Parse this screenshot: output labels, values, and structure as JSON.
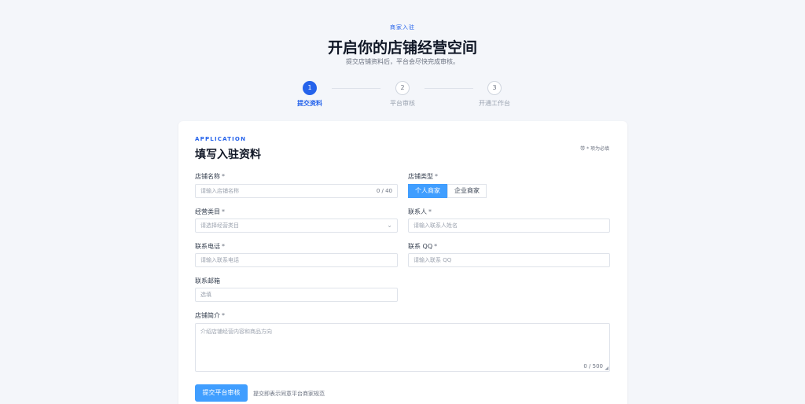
{
  "hero": {
    "eyebrow": "商家入驻",
    "title": "开启你的店铺经营空间",
    "subtitle": "提交店铺资料后，平台会尽快完成审核。"
  },
  "steps": [
    {
      "number": "1",
      "label": "提交资料",
      "active": true
    },
    {
      "number": "2",
      "label": "平台审核",
      "active": false
    },
    {
      "number": "3",
      "label": "开通工作台",
      "active": false
    }
  ],
  "form": {
    "kicker": "APPLICATION",
    "title": "填写入驻资料",
    "required_note": "带 * 项为必填",
    "required_mark": "*",
    "store_name": {
      "label": "店铺名称",
      "placeholder": "请输入店铺名称",
      "counter": "0 / 40"
    },
    "store_type": {
      "label": "店铺类型",
      "options": [
        "个人商家",
        "企业商家"
      ],
      "selected": "个人商家"
    },
    "category": {
      "label": "经营类目",
      "placeholder": "请选择经营类目"
    },
    "contact": {
      "label": "联系人",
      "placeholder": "请输入联系人姓名"
    },
    "phone": {
      "label": "联系电话",
      "placeholder": "请输入联系电话"
    },
    "qq": {
      "label": "联系 QQ",
      "placeholder": "请输入联系 QQ"
    },
    "email": {
      "label": "联系邮箱",
      "placeholder": "选填"
    },
    "intro": {
      "label": "店铺简介",
      "placeholder": "介绍店铺经营内容和商品方向",
      "counter": "0 / 500"
    },
    "submit_label": "提交平台审核",
    "submit_note": "提交即表示同意平台商家规范"
  },
  "colors": {
    "accent": "#2563eb",
    "button": "#409eff",
    "background": "#f4f6fa"
  }
}
